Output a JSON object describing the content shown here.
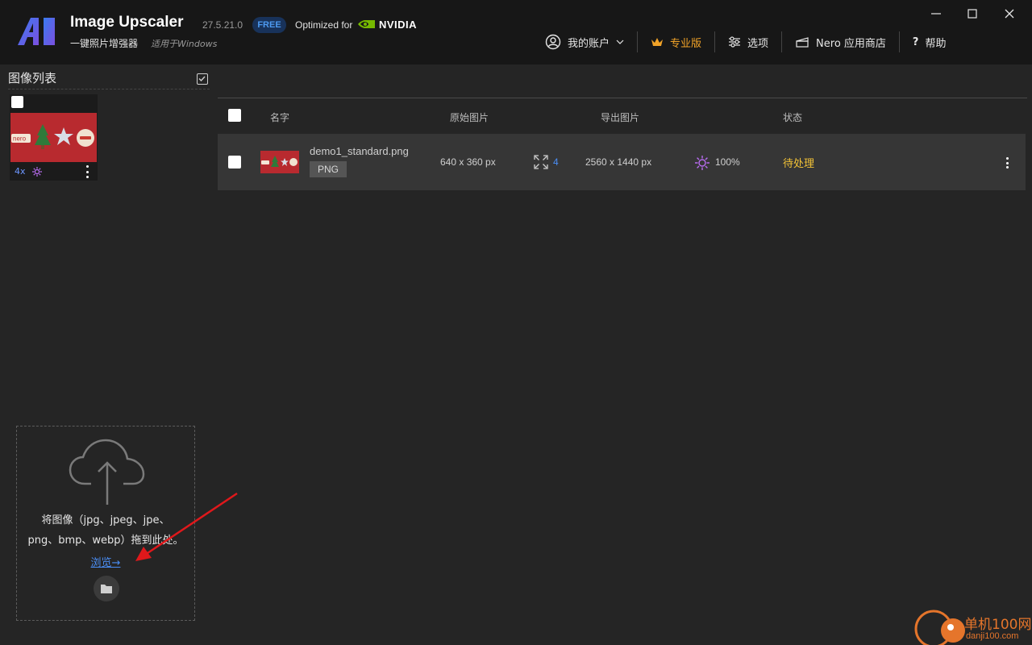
{
  "app": {
    "logo_text": "AI",
    "title": "Image Upscaler",
    "version": "27.5.21.0",
    "badge": "FREE",
    "optimized_label": "Optimized for",
    "nvidia_label": "NVIDIA",
    "subtitle": "一键照片增强器",
    "subtitle_note": "适用于Windows"
  },
  "nav": {
    "account": "我的账户",
    "pro": "专业版",
    "options": "选项",
    "store": "Nero 应用商店",
    "help": "帮助"
  },
  "sidebar": {
    "title": "图像列表",
    "thumb": {
      "scale": "4x",
      "logo_text": "nero"
    }
  },
  "dropzone": {
    "line1": "将图像（jpg、jpeg、jpe、",
    "line2": "png、bmp、webp）拖到此处。",
    "browse": "浏览→"
  },
  "table": {
    "columns": [
      "名字",
      "原始图片",
      "导出图片",
      "状态"
    ],
    "rows": [
      {
        "filename": "demo1_standard.png",
        "format": "PNG",
        "original": "640 x 360 px",
        "scale": "4",
        "output": "2560 x 1440 px",
        "quality": "100%",
        "status": "待处理"
      }
    ]
  },
  "watermark": {
    "text": "单机100网",
    "url": "danji100.com"
  },
  "colors": {
    "accent": "#4a8ef5",
    "pro": "#f1a328",
    "status_pending": "#f2c237",
    "nvidia_green": "#76b900",
    "enhance_purple": "#b86cf0",
    "arrow_red": "#e0181b"
  }
}
